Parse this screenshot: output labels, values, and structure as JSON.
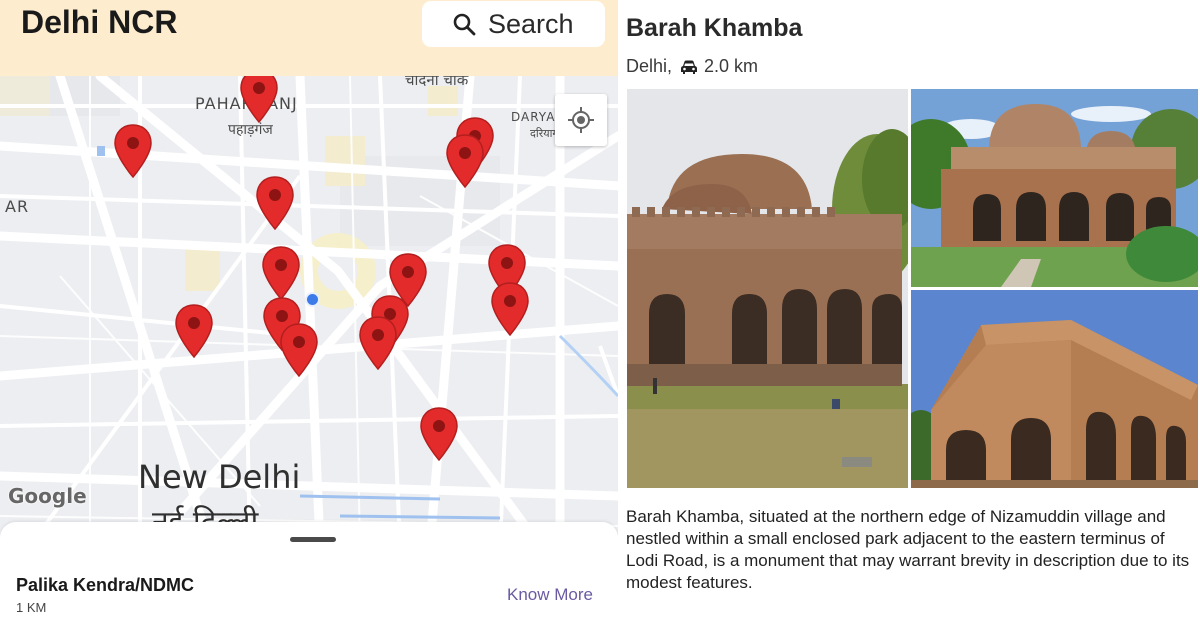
{
  "app": {
    "title": "Delhi NCR",
    "search_label": "Search"
  },
  "map": {
    "labels": {
      "paharganj": "PAHARGANJ",
      "paharganj_hi": "पहाड़गंज",
      "chandni_chowk_hi": "चांदनी चौक",
      "daryaganj": "DARYAG",
      "daryaganj_hi": "दरियागं",
      "ar_fragment": "AR",
      "new_delhi": "New Delhi",
      "new_delhi_hi": "नई दिल्ली"
    },
    "attribution": "Google",
    "pin_color": "#e32b2b",
    "user_location_color": "#3d7be8",
    "marker_count": 15
  },
  "bottom_sheet": {
    "place_name": "Palika Kendra/NDMC",
    "distance": "1 KM",
    "action": "Know More"
  },
  "detail": {
    "title": "Barah Khamba",
    "city": "Delhi,",
    "distance": "2.0 km",
    "description": "Barah Khamba, situated at the northern edge of Nizamuddin village and nestled within a small enclosed park adjacent to the eastern terminus of Lodi Road, is a monument that may warrant brevity in description due to its modest features.",
    "images": [
      "monument-photo-main",
      "monument-photo-top",
      "monument-photo-bottom"
    ]
  },
  "colors": {
    "header_bg": "#fdedce",
    "accent_link": "#6b5aa2"
  }
}
